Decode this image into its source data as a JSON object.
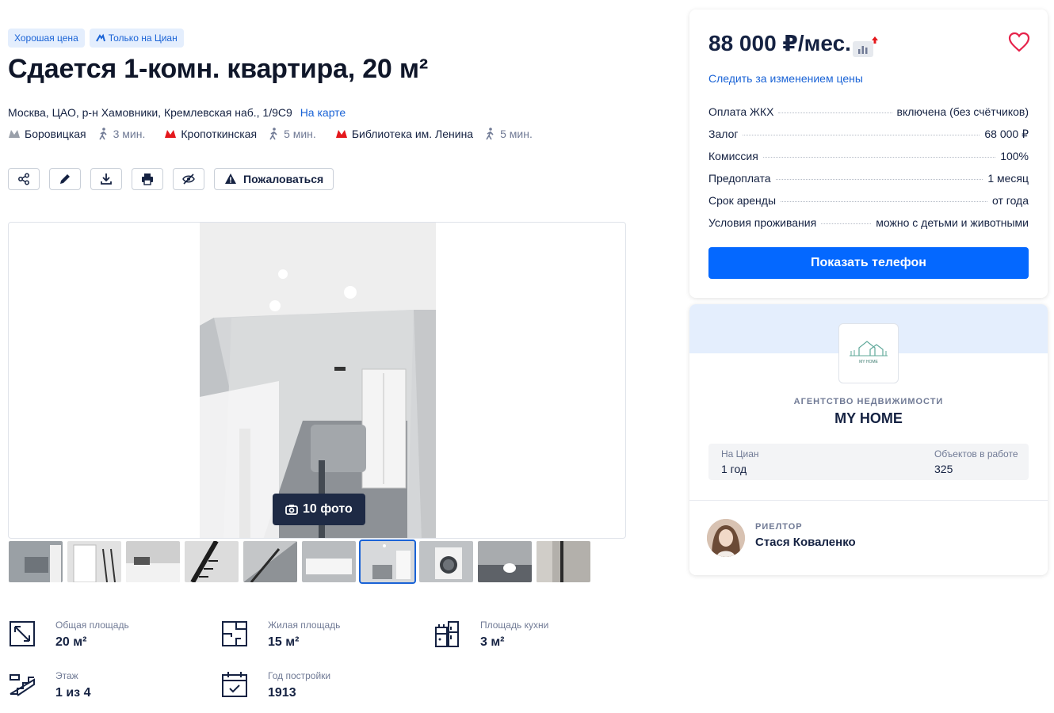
{
  "badges": {
    "good_price": "Хорошая цена",
    "only_cian": "Только на Циан"
  },
  "listing": {
    "title": "Сдается 1-комн. квартира, 20 м²",
    "address": "Москва, ЦАО, р-н Хамовники, Кремлевская наб., 1/9С9",
    "map_link": "На карте"
  },
  "metro": [
    {
      "name": "Боровицкая",
      "time": "3 мин.",
      "color": "#9aa0aa"
    },
    {
      "name": "Кропоткинская",
      "time": "5 мин.",
      "color": "#e4181c"
    },
    {
      "name": "Библиотека им. Ленина",
      "time": "5 мин.",
      "color": "#e4181c"
    }
  ],
  "toolbar": {
    "icons": [
      "share-icon",
      "edit-icon",
      "download-icon",
      "print-icon",
      "hide-icon"
    ],
    "complain_label": "Пожаловаться"
  },
  "gallery": {
    "photo_count": "10 фото",
    "thumbnail_count": 10,
    "active_thumbnail": 7
  },
  "specs": [
    {
      "label": "Общая площадь",
      "value": "20 м²",
      "icon": "area-icon"
    },
    {
      "label": "Жилая площадь",
      "value": "15 м²",
      "icon": "living-area-icon"
    },
    {
      "label": "Площадь кухни",
      "value": "3 м²",
      "icon": "kitchen-icon"
    },
    {
      "label": "Этаж",
      "value": "1 из 4",
      "icon": "floor-icon"
    },
    {
      "label": "Год постройки",
      "value": "1913",
      "icon": "calendar-icon"
    }
  ],
  "price_card": {
    "price": "88 000 ₽/мес.",
    "follow_price": "Следить за изменением цены",
    "terms": [
      {
        "label": "Оплата ЖКХ",
        "value": "включена (без счётчиков)"
      },
      {
        "label": "Залог",
        "value": "68 000 ₽"
      },
      {
        "label": "Комиссия",
        "value": "100%"
      },
      {
        "label": "Предоплата",
        "value": "1 месяц"
      },
      {
        "label": "Срок аренды",
        "value": "от года"
      },
      {
        "label": "Условия проживания",
        "value": "можно с детьми и животными"
      }
    ],
    "show_phone_label": "Показать телефон",
    "accent_color": "#0468ff",
    "heart_color": "#e6224a"
  },
  "agent_card": {
    "agency_type": "АГЕНТСТВО НЕДВИЖИМОСТИ",
    "agency_name": "MY HOME",
    "logo_text": "MY HOME",
    "on_cian_label": "На Циан",
    "on_cian_value": "1 год",
    "objects_label": "Объектов в работе",
    "objects_value": "325",
    "realtor_role": "РИЕЛТОР",
    "realtor_name": "Стася Коваленко"
  }
}
